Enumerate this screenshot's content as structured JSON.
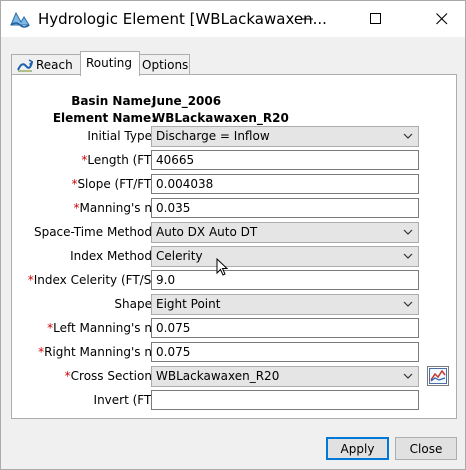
{
  "window": {
    "title": "Hydrologic Element [WBLackawaxen...",
    "icon": "hydrologic-element-icon"
  },
  "tabs": [
    {
      "label": "Reach",
      "icon": "reach-icon"
    },
    {
      "label": "Routing",
      "selected": true
    },
    {
      "label": "Options"
    }
  ],
  "header": {
    "basin_label": "Basin Name:",
    "basin_value": "June_2006",
    "element_label": "Element Name:",
    "element_value": "WBLackawaxen_R20"
  },
  "fields": {
    "initial_type": {
      "label": "Initial Type:",
      "value": "Discharge = Inflow"
    },
    "length": {
      "label": "Length (FT)",
      "value": "40665"
    },
    "slope": {
      "label": "Slope (FT/FT)",
      "value": "0.004038"
    },
    "mannings_n": {
      "label": "Manning's n:",
      "value": "0.035"
    },
    "space_time_method": {
      "label": "Space-Time Method:",
      "value": "Auto DX Auto DT"
    },
    "index_method": {
      "label": "Index Method:",
      "value": "Celerity"
    },
    "index_celerity": {
      "label": "Index Celerity (FT/S)",
      "value": "9.0"
    },
    "shape": {
      "label": "Shape:",
      "value": "Eight Point"
    },
    "left_mannings_n": {
      "label": "Left Manning's n:",
      "value": "0.075"
    },
    "right_mannings_n": {
      "label": "Right Manning's n:",
      "value": "0.075"
    },
    "cross_section": {
      "label": "Cross Section:",
      "value": "WBLackawaxen_R20"
    },
    "invert": {
      "label": "Invert (FT)",
      "value": ""
    }
  },
  "required_marker": "*",
  "buttons": {
    "apply": "Apply",
    "close": "Close"
  },
  "colors": {
    "required": "#d40000",
    "focus_border": "#0078d7"
  }
}
